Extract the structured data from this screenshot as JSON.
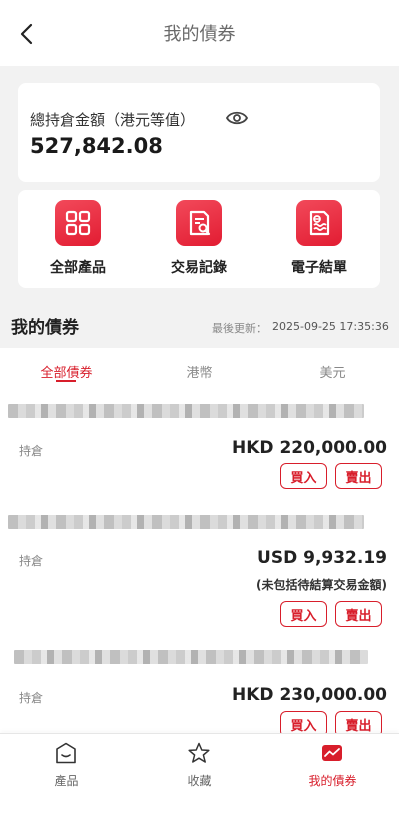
{
  "header": {
    "title": "我的債券",
    "back_icon": "chevron-left-icon"
  },
  "summary": {
    "label": "總持倉金額（港元等值）",
    "value": "527,842.08",
    "visibility_icon": "eye-icon"
  },
  "menu": [
    {
      "label": "全部產品",
      "icon": "grid-icon"
    },
    {
      "label": "交易記錄",
      "icon": "document-search-icon"
    },
    {
      "label": "電子結單",
      "icon": "e-statement-icon"
    }
  ],
  "section": {
    "title": "我的債券",
    "update_label": "最後更新：",
    "update_time": "2025-09-25 17:35:36"
  },
  "tabs": [
    {
      "label": "全部債券",
      "active": true
    },
    {
      "label": "港幣",
      "active": false
    },
    {
      "label": "美元",
      "active": false
    }
  ],
  "bonds": [
    {
      "hold_label": "持倉",
      "amount": "HKD 220,000.00",
      "note": "",
      "buy": "買入",
      "sell": "賣出"
    },
    {
      "hold_label": "持倉",
      "amount": "USD 9,932.19",
      "note": "(未包括待結算交易金額)",
      "buy": "買入",
      "sell": "賣出"
    },
    {
      "hold_label": "持倉",
      "amount": "HKD 230,000.00",
      "note": "",
      "buy": "買入",
      "sell": "賣出"
    }
  ],
  "bottom_nav": [
    {
      "label": "產品",
      "icon": "home-box-icon",
      "active": false
    },
    {
      "label": "收藏",
      "icon": "star-icon",
      "active": false
    },
    {
      "label": "我的債券",
      "icon": "trend-chart-icon",
      "active": true
    }
  ],
  "colors": {
    "accent": "#d81e2b",
    "background": "#f2f2f2"
  }
}
